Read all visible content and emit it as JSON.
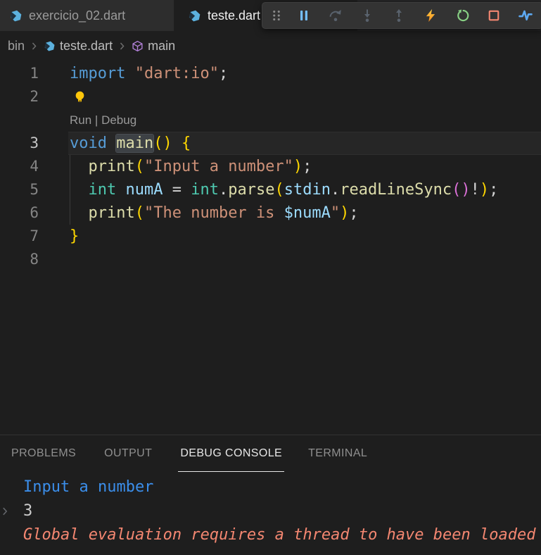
{
  "tab_bar": {
    "tabs": [
      {
        "label": "exercicio_02.dart",
        "icon": "dart",
        "active": false
      },
      {
        "label": "teste.dart",
        "icon": "dart",
        "active": true
      }
    ]
  },
  "debug_toolbar": {
    "buttons": [
      {
        "name": "gripper",
        "icon": "gripper",
        "color": "#8a8a8a",
        "disabled": false
      },
      {
        "name": "pause",
        "icon": "pause",
        "color": "#75beff",
        "disabled": false
      },
      {
        "name": "step-over",
        "icon": "step-over",
        "color": "#59626d",
        "disabled": true
      },
      {
        "name": "step-into",
        "icon": "step-into",
        "color": "#59626d",
        "disabled": true
      },
      {
        "name": "step-out",
        "icon": "step-out",
        "color": "#59626d",
        "disabled": true
      },
      {
        "name": "hot-reload",
        "icon": "bolt",
        "color": "#ffa123",
        "disabled": false
      },
      {
        "name": "restart",
        "icon": "restart",
        "color": "#89d185",
        "disabled": false
      },
      {
        "name": "stop",
        "icon": "stop",
        "color": "#f48771",
        "disabled": false
      },
      {
        "name": "open-devtools",
        "icon": "pulse",
        "color": "#5da9f2",
        "disabled": false
      }
    ]
  },
  "breadcrumb": {
    "items": [
      {
        "label": "bin",
        "icon": null
      },
      {
        "label": "teste.dart",
        "icon": "dart"
      },
      {
        "label": "main",
        "icon": "cube"
      }
    ]
  },
  "editor": {
    "codelens": {
      "run": "Run",
      "separator": " | ",
      "debug": "Debug"
    },
    "lines": [
      {
        "num": "1",
        "kind": "code",
        "current": false,
        "tokens": [
          [
            "kw",
            "import"
          ],
          [
            "pun",
            " "
          ],
          [
            "str",
            "\"dart:io\""
          ],
          [
            "pun",
            ";"
          ]
        ]
      },
      {
        "num": "2",
        "kind": "bulb",
        "current": false,
        "tokens": []
      },
      {
        "num": "",
        "kind": "lens",
        "current": false,
        "tokens": []
      },
      {
        "num": "3",
        "kind": "code",
        "current": true,
        "tokens": [
          [
            "kw",
            "void"
          ],
          [
            "pun",
            " "
          ],
          [
            "fnhl",
            "main"
          ],
          [
            "b1",
            "()"
          ],
          [
            "pun",
            " "
          ],
          [
            "b1",
            "{"
          ]
        ]
      },
      {
        "num": "4",
        "kind": "code",
        "current": false,
        "tokens": [
          [
            "pun",
            "  "
          ],
          [
            "fn",
            "print"
          ],
          [
            "b1",
            "("
          ],
          [
            "str",
            "\"Input a number\""
          ],
          [
            "b1",
            ")"
          ],
          [
            "pun",
            ";"
          ]
        ]
      },
      {
        "num": "5",
        "kind": "code",
        "current": false,
        "tokens": [
          [
            "pun",
            "  "
          ],
          [
            "type",
            "int"
          ],
          [
            "pun",
            " "
          ],
          [
            "var",
            "numA"
          ],
          [
            "pun",
            " = "
          ],
          [
            "type",
            "int"
          ],
          [
            "pun",
            "."
          ],
          [
            "fn",
            "parse"
          ],
          [
            "b1",
            "("
          ],
          [
            "var",
            "stdin"
          ],
          [
            "pun",
            "."
          ],
          [
            "fn",
            "readLineSync"
          ],
          [
            "b2",
            "()"
          ],
          [
            "pun",
            "!"
          ],
          [
            "b1",
            ")"
          ],
          [
            "pun",
            ";"
          ]
        ]
      },
      {
        "num": "6",
        "kind": "code",
        "current": false,
        "tokens": [
          [
            "pun",
            "  "
          ],
          [
            "fn",
            "print"
          ],
          [
            "b1",
            "("
          ],
          [
            "str",
            "\"The number is "
          ],
          [
            "var",
            "$numA"
          ],
          [
            "str",
            "\""
          ],
          [
            "b1",
            ")"
          ],
          [
            "pun",
            ";"
          ]
        ]
      },
      {
        "num": "7",
        "kind": "code",
        "current": false,
        "tokens": [
          [
            "b1",
            "}"
          ]
        ]
      },
      {
        "num": "8",
        "kind": "code",
        "current": false,
        "tokens": []
      }
    ]
  },
  "panel": {
    "tabs": [
      {
        "label": "PROBLEMS",
        "active": false
      },
      {
        "label": "OUTPUT",
        "active": false
      },
      {
        "label": "DEBUG CONSOLE",
        "active": true
      },
      {
        "label": "TERMINAL",
        "active": false
      }
    ],
    "console": [
      {
        "text": "Input a number",
        "style": "stdout-blue",
        "expandable": false
      },
      {
        "text": "3",
        "style": "plain",
        "expandable": true
      },
      {
        "text": "Global evaluation requires a thread to have been loaded",
        "style": "error-italic",
        "expandable": false
      }
    ]
  },
  "colors": {
    "editor_bg": "#1e1e1e",
    "tabbar_bg": "#252526",
    "inactive_tab_bg": "#2d2d2d",
    "toolbar_bg": "#333333",
    "keyword": "#569cd6",
    "type": "#4ec9b0",
    "variable": "#9cdcfe",
    "function": "#dcdcaa",
    "string": "#ce9178",
    "bracket_level1": "#ffd700",
    "bracket_level2": "#da70d6",
    "stdout_blue": "#3b8eea",
    "error_red": "#f48771",
    "restart_green": "#89d185",
    "hot_reload_orange": "#ffa123",
    "pause_blue": "#75beff"
  }
}
